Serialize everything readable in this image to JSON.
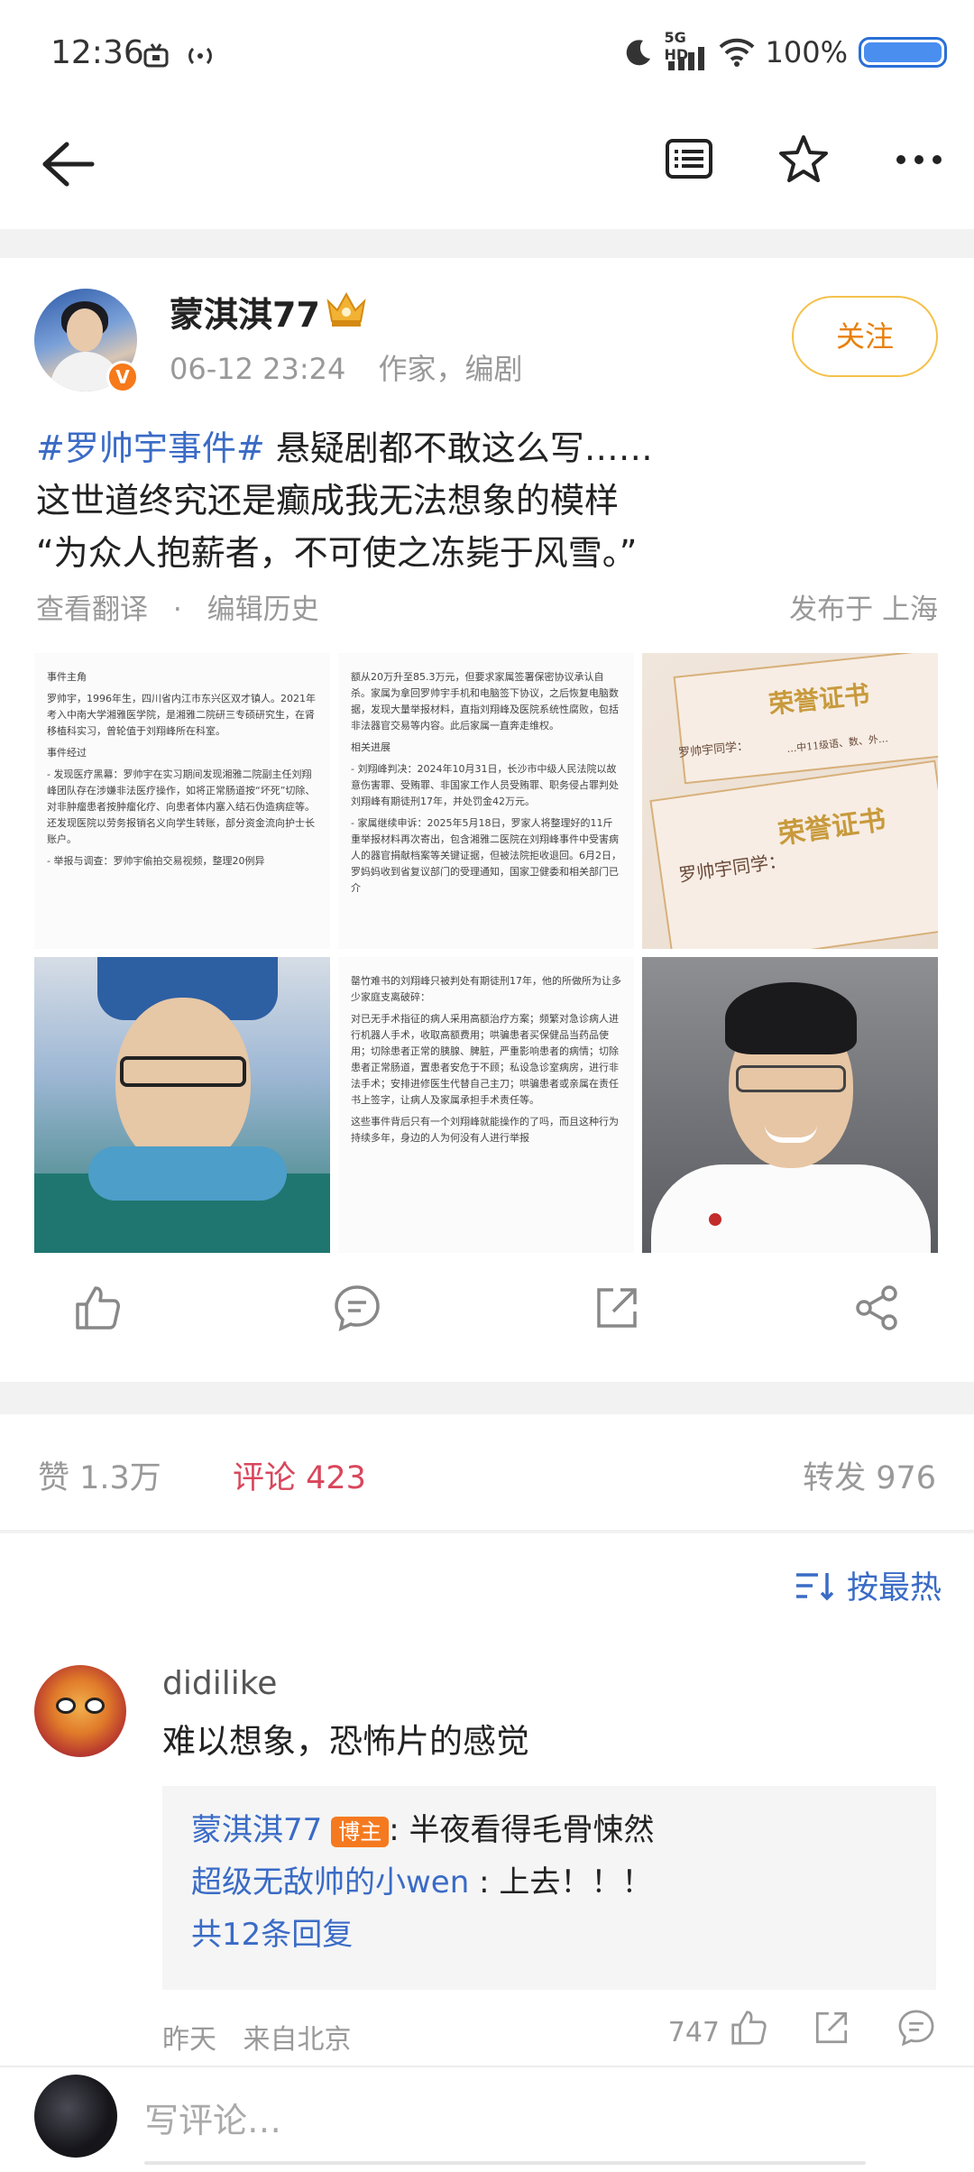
{
  "status_bar": {
    "time": "12:36",
    "network": "5G HD",
    "battery": "100%"
  },
  "post": {
    "author": "蒙淇淇77",
    "date": "06-12 23:24",
    "roles": "作家，编剧",
    "follow_label": "关注",
    "hashtag": "#罗帅宇事件#",
    "line1_rest": " 悬疑剧都不敢这么写……",
    "line2": "这世道终究还是癫成我无法想象的模样",
    "line3": "“为众人抱薪者，不可使之冻毙于风雪。”",
    "translate": "查看翻译",
    "dot": "·",
    "edit_history": "编辑历史",
    "location": "发布于 上海",
    "images": {
      "doc1": [
        "事件主角",
        "罗帅宇，1996年生，四川省内江市东兴区双才镇人。2021年考入中南大学湘雅医学院，是湘雅二院研三专硕研究生，在肾移植科实习，曾轮值于刘翔峰所在科室。",
        "事件经过",
        "- 发现医疗黑幕：罗帅宇在实习期间发现湘雅二院副主任刘翔峰团队存在涉嫌非法医疗操作，如将正常肠道按“坏死”切除、对非肿瘤患者按肿瘤化疗、向患者体内塞入结石伪造病症等。还发现医院以劳务报销名义向学生转账，部分资金流向护士长账户。",
        "- 举报与调查：罗帅宇偷拍交易视频，整理20例异"
      ],
      "doc2": [
        "额从20万升至85.3万元，但要求家属签署保密协议承认自杀。家属为拿回罗帅宇手机和电脑签下协议，之后恢复电脑数据，发现大量举报材料，直指刘翔峰及医院系统性腐败，包括非法器官交易等内容。此后家属一直奔走维权。",
        "相关进展",
        "- 刘翔峰判决：2024年10月31日，长沙市中级人民法院以故意伤害罪、受贿罪、非国家工作人员受贿罪、职务侵占罪判处刘翔峰有期徒刑17年，并处罚金42万元。",
        "- 家属继续申诉：2025年5月18日，罗家人将整理好的11斤重举报材料再次寄出，包含湘雅二医院在刘翔峰事件中受害病人的器官捐献档案等关键证据，但被法院拒收退回。6月2日，罗妈妈收到省复议部门的受理通知，国家卫健委和相关部门已介"
      ],
      "doc3": [
        "罄竹难书的刘翔峰只被判处有期徒刑17年，他的所做所为让多少家庭支离破碎：",
        "对已无手术指征的病人采用高额治疗方案；频繁对急诊病人进行机器人手术，收取高额费用；哄骗患者买保健品当药品使用；切除患者正常的胰腺、脾脏，严重影响患者的病情；切除患者正常肠道，置患者安危于不顾；私设急诊室病房，进行非法手术；安排进修医生代替自己主刀；哄骗患者或亲属在责任书上签字，让病人及家属承担手术责任等。",
        "这些事件背后只有一个刘翔峰就能操作的了吗，而且这种行为持续多年，身边的人为何没有人进行举报"
      ],
      "cert_title": "荣誉证书",
      "cert_name": "罗帅宇同学：",
      "cert_line": "…中11级语、数、外…"
    }
  },
  "actions": {
    "like_icon": "thumbs-up-icon",
    "comment_icon": "comment-icon",
    "repost_icon": "share-out-icon",
    "share_icon": "share-network-icon"
  },
  "stats": {
    "likes": "赞 1.3万",
    "comments": "评论 423",
    "reposts": "转发 976"
  },
  "sort": {
    "label": "按最热"
  },
  "comment": {
    "user": "didilike",
    "text": "难以想象，恐怖片的感觉",
    "reply1_name": "蒙淇淇77",
    "reply1_badge": "博主",
    "reply1_text": ": 半夜看得毛骨悚然",
    "reply2_name": "超级无敌帅的小wen",
    "reply2_text": " : 上去！！！",
    "more": "共12条回复",
    "time": "昨天",
    "from": "来自北京",
    "likes": "747"
  },
  "input": {
    "placeholder": "写评论…"
  },
  "colors": {
    "link_blue": "#3a6bc6",
    "accent_orange": "#e8800a",
    "comment_red": "#d9465c"
  }
}
